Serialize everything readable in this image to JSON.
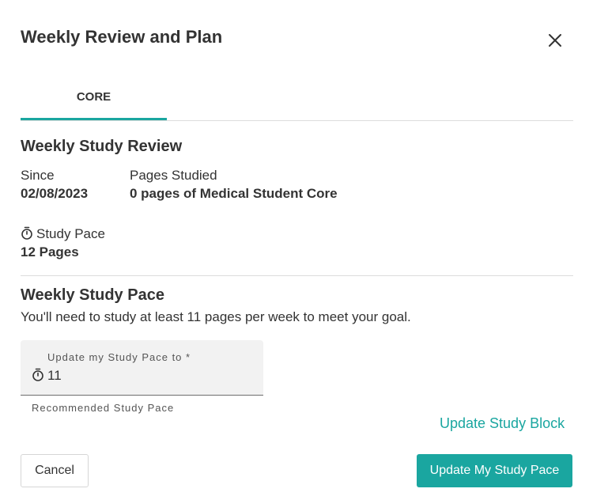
{
  "dialog": {
    "title": "Weekly Review and Plan",
    "close_icon": "close-icon"
  },
  "tabs": [
    {
      "label": "CORE",
      "active": true
    }
  ],
  "review": {
    "heading": "Weekly Study Review",
    "since_label": "Since",
    "since_value": "02/08/2023",
    "pages_label": "Pages Studied",
    "pages_value": "0 pages of Medical Student Core",
    "pace_icon": "timer-icon",
    "pace_label": "Study Pace",
    "pace_value": "12 Pages"
  },
  "pace": {
    "heading": "Weekly Study Pace",
    "description": "You'll need to study at least 11 pages per week to meet your goal.",
    "field_label": "Update my Study Pace to *",
    "field_icon": "timer-icon",
    "field_value": "11",
    "helper_text": "Recommended Study Pace"
  },
  "actions": {
    "update_block_link": "Update Study Block",
    "cancel_label": "Cancel",
    "submit_label": "Update My Study Pace"
  },
  "colors": {
    "accent": "#1aa6a0",
    "text": "#333333",
    "field_bg": "#f2f2f2"
  }
}
